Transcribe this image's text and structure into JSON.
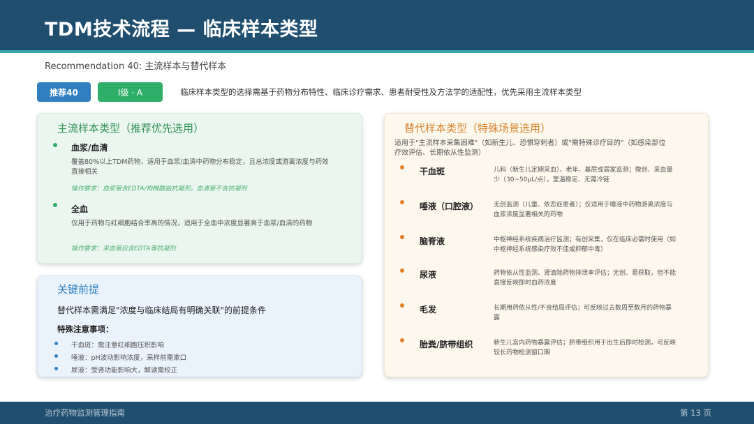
{
  "header": {
    "title": "TDM技术流程 — 临床样本类型"
  },
  "subtitle": "Recommendation 40: 主流样本与替代样本",
  "badges": {
    "recommend": "推荐40",
    "level": "Ⅰ级 · A"
  },
  "intro": "临床样本类型的选择需基于药物分布特性、临床诊疗需求、患者耐受性及方法学的适配性，优先采用主流样本类型",
  "main_card": {
    "title": "主流样本类型（推荐优先选用）",
    "items": [
      {
        "name": "血浆/血清",
        "desc_line1": "覆盖80%以上TDM药物，适用于血浆/血清中药物分布稳定，且总浓度或游离浓度与药效",
        "desc_line2": "直接相关",
        "requirement": "操作要求：血浆管含EDTA/枸橼酸盐抗凝剂，血清管不含抗凝剂"
      },
      {
        "name": "全血",
        "desc_line1": "仅用于药物与红细胞结合率高的情况，适用于全血中浓度显著高于血浆/血清的药物",
        "requirement": "操作要求：采血管应含EDTA等抗凝剂"
      }
    ]
  },
  "key_card": {
    "title": "关键前提",
    "text": "替代样本需满足\"浓度与临床结局有明确关联\"的前提条件",
    "sub_title": "特殊注意事项：",
    "bullets": [
      "干血斑：需注意红细胞压积影响",
      "唾液：pH波动影响浓度，采样前需漱口",
      "尿液：受肾功能影响大，解读需校正"
    ]
  },
  "alt_card": {
    "title": "替代样本类型（特殊场景选用）",
    "intro_line1": "适用于\"主流样本采集困难\"（如新生儿、恐惧穿刺者）或\"需特殊诊疗目的\"（如感染部位",
    "intro_line2": "疗效评估、长期依从性监测）",
    "items": [
      {
        "name": "干血斑",
        "desc1": "儿科（新生儿定期采血）、老年、基层或居家监测；微创、采血量",
        "desc2": "少（30~50μL/点），室温稳定、无需冷链"
      },
      {
        "name": "唾液（口腔液）",
        "desc1": "无创监测（儿童、依恋症患者）；仅适用于唾液中药物游离浓度与",
        "desc2": "血浆浓度显著相关的药物"
      },
      {
        "name": "脑脊液",
        "desc1": "中枢神经系统疾病治疗监测；有创采集，仅在临床必需时使用（如",
        "desc2": "中枢神经系统感染疗效不佳或抑郁中毒）"
      },
      {
        "name": "尿液",
        "desc1": "药物依从性监测、肾清除药物排泄率评估；无创、易获取，但不能",
        "desc2": "直接反映即时血药浓度"
      },
      {
        "name": "毛发",
        "desc1": "长期用药依从性/不良结局评估；可反映过去数周至数月的药物暴",
        "desc2": "露"
      },
      {
        "name": "胎粪/脐带组织",
        "desc1": "新生儿宫内药物暴露评估；脐带组织用于出生后即时检测，可反映",
        "desc2": "较长药物检测窗口期"
      }
    ]
  },
  "footer": {
    "left": "治疗药物监测管理指南",
    "right": "第 13 页"
  }
}
